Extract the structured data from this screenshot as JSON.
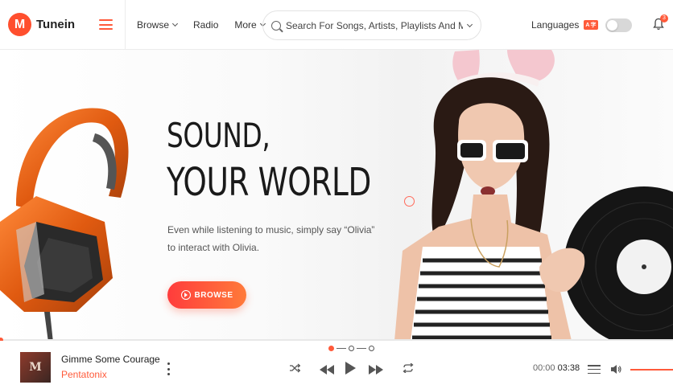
{
  "header": {
    "brand_letter": "M",
    "brand_name": "Tunein",
    "nav": [
      {
        "label": "Browse",
        "has_dropdown": true
      },
      {
        "label": "Radio",
        "has_dropdown": false
      },
      {
        "label": "More",
        "has_dropdown": true
      }
    ],
    "search": {
      "placeholder": "Search For Songs, Artists, Playlists And More.."
    },
    "languages_label": "Languages",
    "languages_badge": "A字",
    "notifications_count": "3"
  },
  "hero": {
    "title_line1": "SOUND,",
    "title_line2": "YOUR WORLD",
    "subtitle": "Even while listening to music, simply say “Olivia” to interact with Olivia.",
    "cta_label": "BROWSE"
  },
  "slider": {
    "count": 3,
    "active_index": 0
  },
  "player": {
    "cover_text": "M",
    "song_title": "Gimme Some Courage",
    "artist": "Pentatonix",
    "current_time": "00:00",
    "duration": "03:38",
    "progress": 0
  },
  "colors": {
    "accent": "#ff5a3a"
  },
  "icons": [
    "hamburger-icon",
    "search-icon",
    "chevron-down-icon",
    "bell-icon",
    "play-circle-icon",
    "shuffle-icon",
    "previous-icon",
    "play-icon",
    "next-icon",
    "repeat-icon",
    "queue-icon",
    "volume-icon",
    "more-vertical-icon"
  ]
}
